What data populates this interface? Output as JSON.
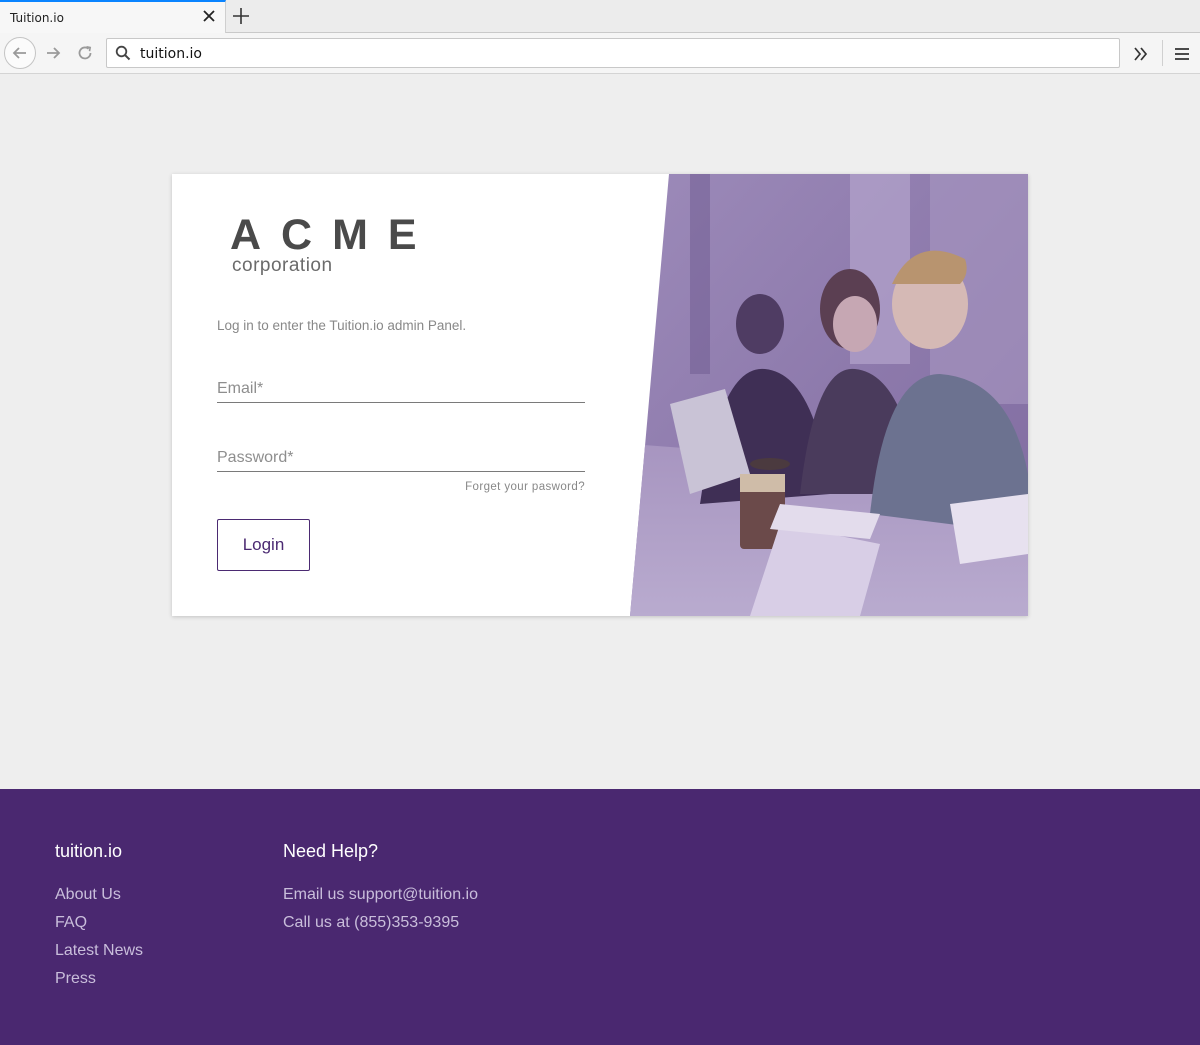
{
  "browser": {
    "tab_title": "Tuition.io",
    "url": "tuition.io"
  },
  "logo": {
    "name": "ACME",
    "subtitle": "corporation"
  },
  "login": {
    "intro": "Log in to enter the Tuition.io admin Panel.",
    "email_placeholder": "Email*",
    "password_placeholder": "Password*",
    "forgot": "Forget your pasword?",
    "button": "Login"
  },
  "footer": {
    "col1": {
      "heading": "tuition.io",
      "links": [
        "About Us",
        "FAQ",
        "Latest News",
        "Press"
      ]
    },
    "col2": {
      "heading": "Need Help?",
      "lines": [
        "Email us support@tuition.io",
        "Call us at (855)353-9395"
      ]
    }
  },
  "colors": {
    "brand_purple": "#4a2870",
    "tab_accent": "#0a84ff",
    "photo_tint": "#8c74ad"
  }
}
